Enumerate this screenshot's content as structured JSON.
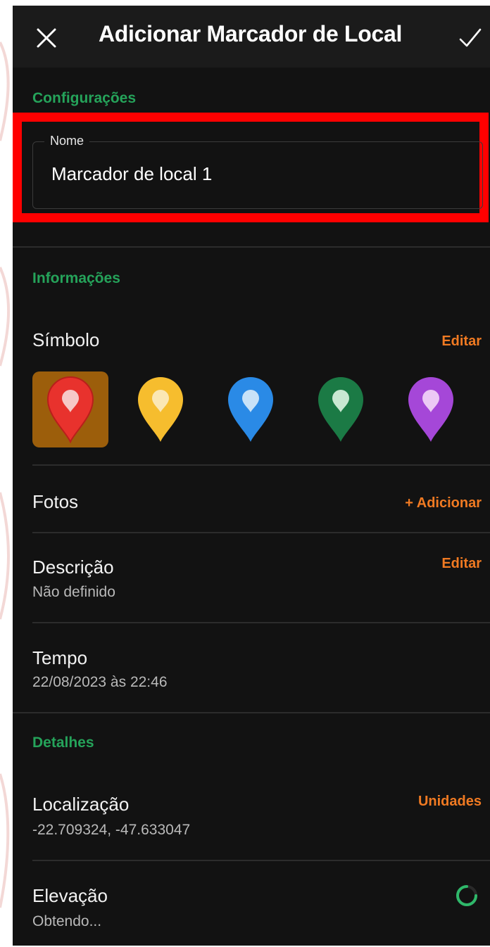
{
  "header": {
    "title": "Adicionar Marcador de Local",
    "close_icon": "close-icon",
    "confirm_icon": "check-icon"
  },
  "settings": {
    "section_title": "Configurações",
    "name_field": {
      "label": "Nome",
      "value": "Marcador de local 1"
    }
  },
  "info": {
    "section_title": "Informações",
    "symbol": {
      "label": "Símbolo",
      "action": "Editar",
      "options": [
        {
          "color": "#e8322d",
          "inner": "#f6c9c7",
          "selected": true
        },
        {
          "color": "#f6bd2e",
          "inner": "#fbe7b4",
          "selected": false
        },
        {
          "color": "#2a8ae6",
          "inner": "#c8e2f8",
          "selected": false
        },
        {
          "color": "#1b7a45",
          "inner": "#c9e8d2",
          "selected": false
        },
        {
          "color": "#a547d8",
          "inner": "#ecc9f5",
          "selected": false
        }
      ]
    },
    "photos": {
      "label": "Fotos",
      "action": "+ Adicionar"
    },
    "description": {
      "label": "Descrição",
      "value": "Não definido",
      "action": "Editar"
    },
    "time": {
      "label": "Tempo",
      "value": "22/08/2023 às 22:46"
    }
  },
  "details": {
    "section_title": "Detalhes",
    "location": {
      "label": "Localização",
      "value": "-22.709324, -47.633047",
      "action": "Unidades"
    },
    "elevation": {
      "label": "Elevação",
      "value": "Obtendo...",
      "status_icon": "loading-spinner-icon"
    }
  },
  "colors": {
    "accent_green": "#25a35a",
    "accent_orange": "#f07a22",
    "highlight_red": "#ff0000",
    "background": "#121212"
  }
}
